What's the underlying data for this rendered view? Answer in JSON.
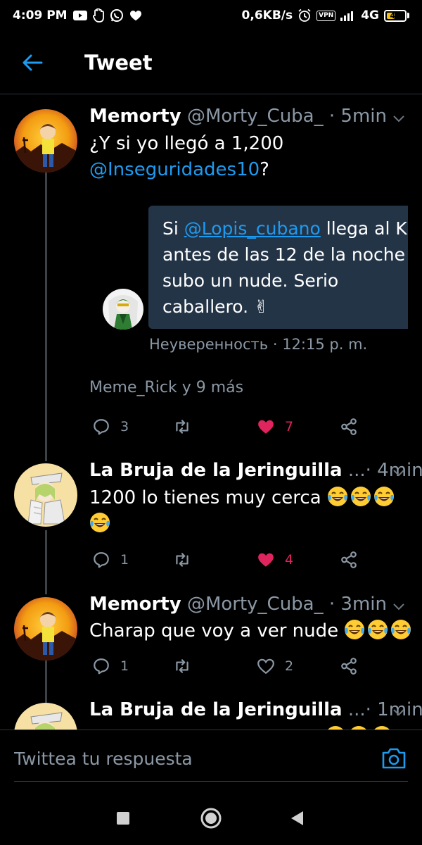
{
  "status_bar": {
    "time": "4:09 PM",
    "network_speed": "0,6KB/s",
    "vpn": "VPN",
    "network_type": "4G",
    "battery": "44",
    "battery_level": 0.44
  },
  "header": {
    "title": "Tweet"
  },
  "tweets": [
    {
      "name": "Memorty",
      "handle": "@Morty_Cuba_",
      "time": "· 5min",
      "text_line1": "¿Y si yo llegó a 1,200",
      "mention": "@Inseguridades10",
      "text_end": "?",
      "quote": {
        "pre": "Si ",
        "link": "@Lopis_cubano",
        "line1_rest": " llega al K",
        "line2": "antes de las 12 de la noche",
        "line3": "subo un nude. Serio",
        "line4": "caballero. ✌",
        "author": "Неуверенность",
        "time": "· 12:15 p. m."
      },
      "likers": "Meme_Rick y 9 más",
      "replies": "3",
      "likes": "7",
      "liked": true
    },
    {
      "name": "La Bruja de la Jeringuilla",
      "handle": "...",
      "time": "· 4min",
      "text": "1200 lo tienes muy cerca",
      "replies": "1",
      "likes": "4",
      "liked": true
    },
    {
      "name": "Memorty",
      "handle": "@Morty_Cuba_",
      "time": "· 3min",
      "text": "Charap que voy a ver nude",
      "replies": "1",
      "likes": "2",
      "liked": false
    },
    {
      "name": "La Bruja de la Jeringuilla",
      "handle": "...",
      "time": "· 1min"
    }
  ],
  "reply": {
    "placeholder": "Twittea tu respuesta"
  },
  "icons": {
    "back": "back-arrow-icon",
    "reply": "reply-icon",
    "retweet": "retweet-icon",
    "like": "heart-icon",
    "share": "share-icon",
    "camera": "camera-icon",
    "emoji": "laughing-emoji-icon"
  },
  "colors": {
    "accent": "#1d9bf0",
    "like": "#e0245e",
    "muted": "#8b98a5",
    "background": "#000000"
  }
}
